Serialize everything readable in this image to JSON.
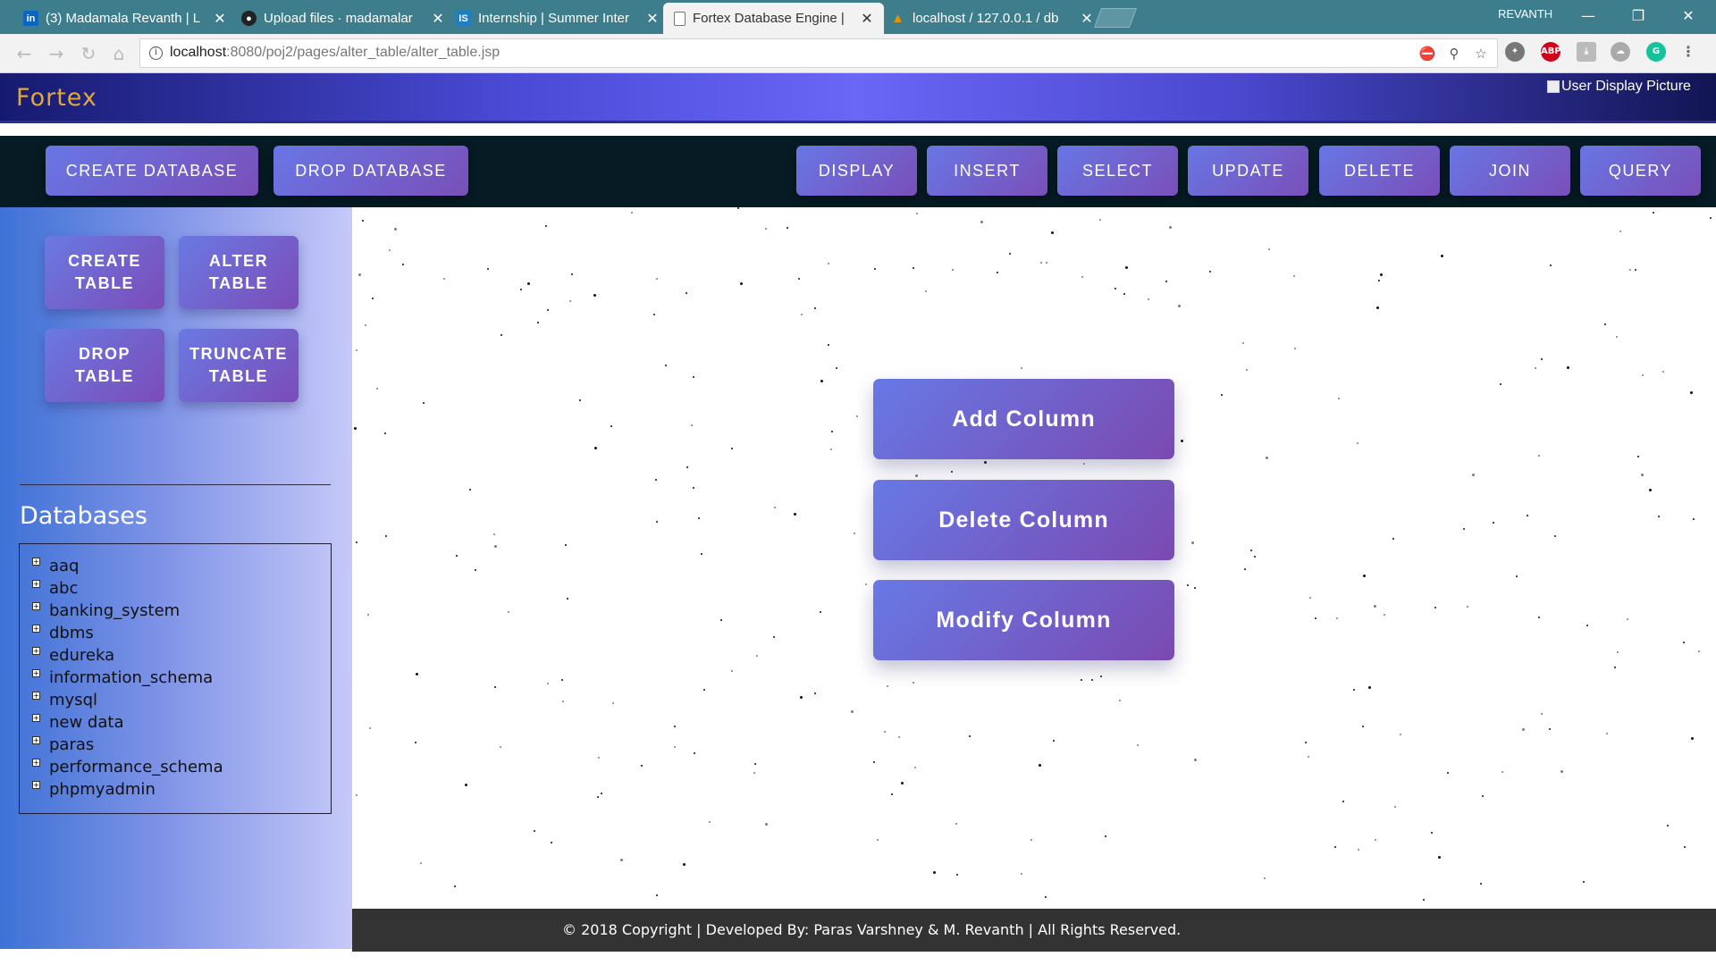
{
  "browser": {
    "tabs": [
      {
        "title": "(3) Madamala Revanth | L",
        "icon": "linkedin-icon"
      },
      {
        "title": "Upload files · madamalar",
        "icon": "github-icon"
      },
      {
        "title": "Internship | Summer Inter",
        "icon": "internshala-icon"
      },
      {
        "title": "Fortex Database Engine |",
        "icon": "page-icon",
        "active": true
      },
      {
        "title": "localhost / 127.0.0.1 / db",
        "icon": "phpmyadmin-icon"
      }
    ],
    "close_glyph": "✕",
    "profile_name": "REVANTH",
    "url_host": "localhost",
    "url_path": ":8080/poj2/pages/alter_table/alter_table.jsp",
    "ext_abp": "ABP",
    "ext_g": "G"
  },
  "header": {
    "brand": "Fortex",
    "user_picture_alt": "User Display Picture"
  },
  "topnav": {
    "left": [
      "CREATE DATABASE",
      "DROP DATABASE"
    ],
    "right": [
      "DISPLAY",
      "INSERT",
      "SELECT",
      "UPDATE",
      "DELETE",
      "JOIN",
      "QUERY"
    ]
  },
  "sidebar": {
    "buttons": [
      {
        "line1": "CREATE",
        "line2": "TABLE"
      },
      {
        "line1": "ALTER",
        "line2": "TABLE"
      },
      {
        "line1": "DROP",
        "line2": "TABLE"
      },
      {
        "line1": "TRUNCATE",
        "line2": "TABLE"
      }
    ],
    "databases_title": "Databases",
    "databases": [
      "aaq",
      "abc",
      "banking_system",
      "dbms",
      "edureka",
      "information_schema",
      "mysql",
      "new data",
      "paras",
      "performance_schema",
      "phpmyadmin"
    ],
    "expand_glyph": "+"
  },
  "main": {
    "actions": [
      "Add Column",
      "Delete Column",
      "Modify Column"
    ]
  },
  "footer": {
    "text": "© 2018 Copyright | Developed By: Paras Varshney & M. Revanth | All Rights Reserved."
  },
  "colors": {
    "brand": "#e0a83a",
    "button_gradient_start": "#6779e6",
    "button_gradient_end": "#7b49b0",
    "navbar": "#061b23",
    "footer": "#333333"
  }
}
